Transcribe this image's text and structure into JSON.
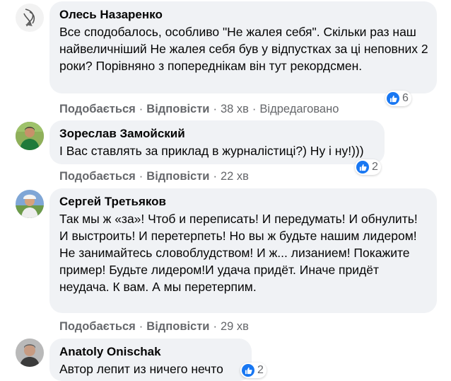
{
  "comments": [
    {
      "author": "Олесь Назаренко",
      "text": "Все сподобалось, особливо \"Не жалея себя\". Скільки раз наш найвеличніший Не жалея себя був у відпустках за ці неповних 2 роки? Порівняно з попереднікам він тут рекордсмен.",
      "reactions": "6",
      "like_label": "Подобається",
      "reply_label": "Відповісти",
      "time": "38 хв",
      "edited": "Відредаговано",
      "avatar_icon": "logo-avatar"
    },
    {
      "author": "Зореслав Замойский",
      "text": "І Вас ставлять за приклад в журналістиці?) Ну і ну!)))",
      "reactions": "2",
      "like_label": "Подобається",
      "reply_label": "Відповісти",
      "time": "22 хв",
      "avatar_icon": "person-avatar"
    },
    {
      "author": "Сергей Третьяков",
      "text": "Так мы ж «за»! Чтоб и переписать! И передумать! И обнулить! И выстроить! И перетерпеть! Но вы ж будьте нашим лидером! Не занимайтесь словоблудством! И ж... лизанием! Покажите пример! Будьте лидером!И удача придёт. Иначе придёт неудача. К вам. А мы перетерпим.",
      "like_label": "Подобається",
      "reply_label": "Відповісти",
      "time": "29 хв",
      "avatar_icon": "person-avatar"
    },
    {
      "author": "Anatoly Onischak",
      "text": "Автор лепит из ничего нечто",
      "reactions": "2",
      "avatar_icon": "person-avatar"
    }
  ],
  "separator": "·",
  "colors": {
    "bubble": "#f0f2f5",
    "like": "#1877f2",
    "meta": "#65676b"
  }
}
